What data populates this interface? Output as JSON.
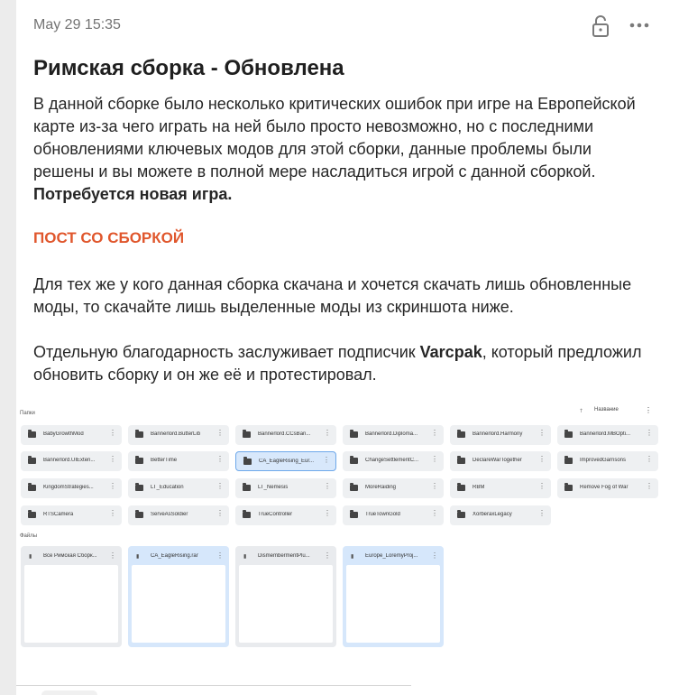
{
  "post": {
    "date": "May 29 15:35",
    "title": "Римская сборка - Обновлена",
    "paragraph1": "В данной сборке было несколько критических ошибок при игре на Европейской карте из-за чего играть на ней было просто невозможно, но с последними обновлениями ключевых модов для этой сборки, данные проблемы были решены и вы можете в полной мере насладиться игрой с данной сборкой. ",
    "paragraph1_bold": "Потребуется новая игра.",
    "link_label": "ПОСТ СО СБОРКОЙ",
    "paragraph2": "Для тех же у кого данная сборка скачана и хочется скачать лишь обновленные моды, то скачайте лишь выделенные моды из скриншота ниже.",
    "paragraph3_start": "Отдельную благодарность заслуживает подписчик ",
    "paragraph3_bold": "Varcpak",
    "paragraph3_end": ", который предложил обновить сборку и он же её и протестировал.",
    "icons": {
      "lock": "lock-open-icon",
      "more": "more-dots-icon"
    },
    "accent_color": "#e0572d"
  },
  "screenshot": {
    "folders_label": "Папки",
    "files_label": "Файлы",
    "sort_label": "Название",
    "folders": [
      {
        "name": "BabyGrowthMod",
        "selected": false
      },
      {
        "name": "Bannerlord.ButterLib",
        "selected": false
      },
      {
        "name": "Bannerlord.CCsBan...",
        "selected": false
      },
      {
        "name": "Bannerlord.Diploma...",
        "selected": false
      },
      {
        "name": "Bannerlord.Harmony",
        "selected": false
      },
      {
        "name": "Bannerlord.MBOpti...",
        "selected": false
      },
      {
        "name": "Bannerlord.UIExten...",
        "selected": false
      },
      {
        "name": "BetterTime",
        "selected": false
      },
      {
        "name": "CA_EagleRising_Eur...",
        "selected": true
      },
      {
        "name": "ChangeSettlementC...",
        "selected": false
      },
      {
        "name": "DeclareWarTogether",
        "selected": false
      },
      {
        "name": "ImprovedGarrisons",
        "selected": false
      },
      {
        "name": "KingdomStrategies...",
        "selected": false
      },
      {
        "name": "LT_Education",
        "selected": false
      },
      {
        "name": "LT_Nemesis",
        "selected": false
      },
      {
        "name": "MoreRaiding",
        "selected": false
      },
      {
        "name": "RBM",
        "selected": false
      },
      {
        "name": "Remove Fog of War",
        "selected": false
      },
      {
        "name": "RTSCamera",
        "selected": false
      },
      {
        "name": "ServeAsSoldier",
        "selected": false
      },
      {
        "name": "TrueController",
        "selected": false
      },
      {
        "name": "TrueTownGold",
        "selected": false
      },
      {
        "name": "XorberaxLegacy",
        "selected": false
      }
    ],
    "files": [
      {
        "name": "Все Римская Сборк...",
        "selected": false
      },
      {
        "name": "CA_EagleRising.rar",
        "selected": true
      },
      {
        "name": "DismembermentPlu...",
        "selected": false
      },
      {
        "name": "Europe_LoremyProj...",
        "selected": true
      }
    ]
  }
}
